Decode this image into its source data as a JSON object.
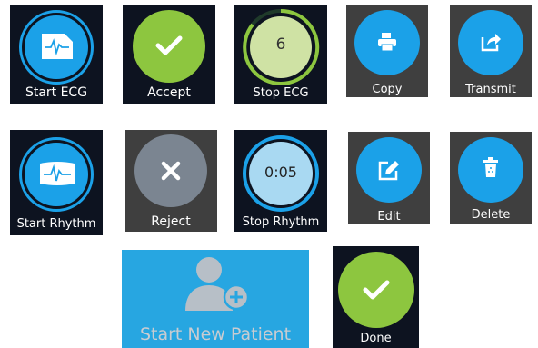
{
  "buttons": {
    "start_ecg": "Start ECG",
    "accept": "Accept",
    "stop_ecg": "Stop ECG",
    "stop_ecg_count": "6",
    "copy": "Copy",
    "transmit": "Transmit",
    "start_rhythm": "Start Rhythm",
    "reject": "Reject",
    "stop_rhythm": "Stop Rhythm",
    "stop_rhythm_timer": "0:05",
    "edit": "Edit",
    "delete": "Delete",
    "start_new_patient": "Start New Patient",
    "done": "Done"
  },
  "colors": {
    "navy": "#0d1320",
    "grey": "#3f3f3f",
    "blue": "#1ba1e8",
    "green": "#8dc63f",
    "reject_grey": "#7b8591",
    "light_green": "#cfe2a4",
    "light_blue": "#a9d9f2",
    "patient_blue": "#27a6e1"
  },
  "icons": {
    "start_ecg": "ecg-card-icon",
    "start_rhythm": "rhythm-strip-icon",
    "accept": "checkmark-icon",
    "reject": "x-icon",
    "copy": "printer-icon",
    "transmit": "share-icon",
    "edit": "pencil-edit-icon",
    "delete": "trash-icon",
    "start_new_patient": "add-person-icon",
    "done": "checkmark-icon"
  }
}
